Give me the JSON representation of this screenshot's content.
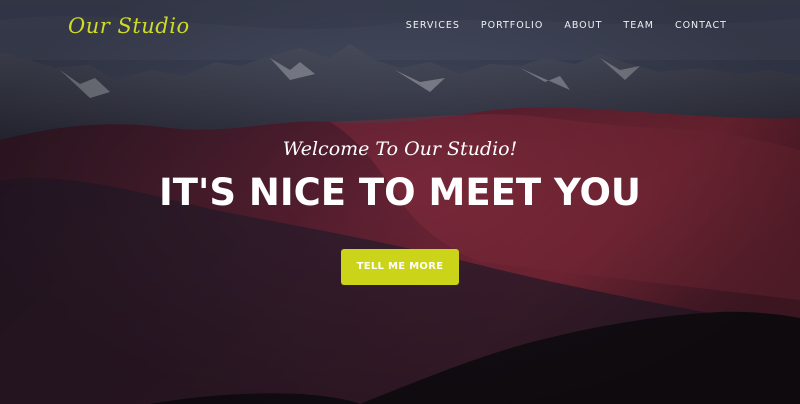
{
  "brand": {
    "name": "Our Studio",
    "color": "#cfdc23"
  },
  "nav": {
    "items": [
      {
        "label": "SERVICES"
      },
      {
        "label": "PORTFOLIO"
      },
      {
        "label": "ABOUT"
      },
      {
        "label": "TEAM"
      },
      {
        "label": "CONTACT"
      }
    ]
  },
  "hero": {
    "subheading": "Welcome To Our Studio!",
    "heading": "IT'S NICE TO MEET YOU",
    "cta_label": "TELL ME MORE",
    "cta_color": "#ccd41a",
    "background_image": "mountain-range"
  }
}
